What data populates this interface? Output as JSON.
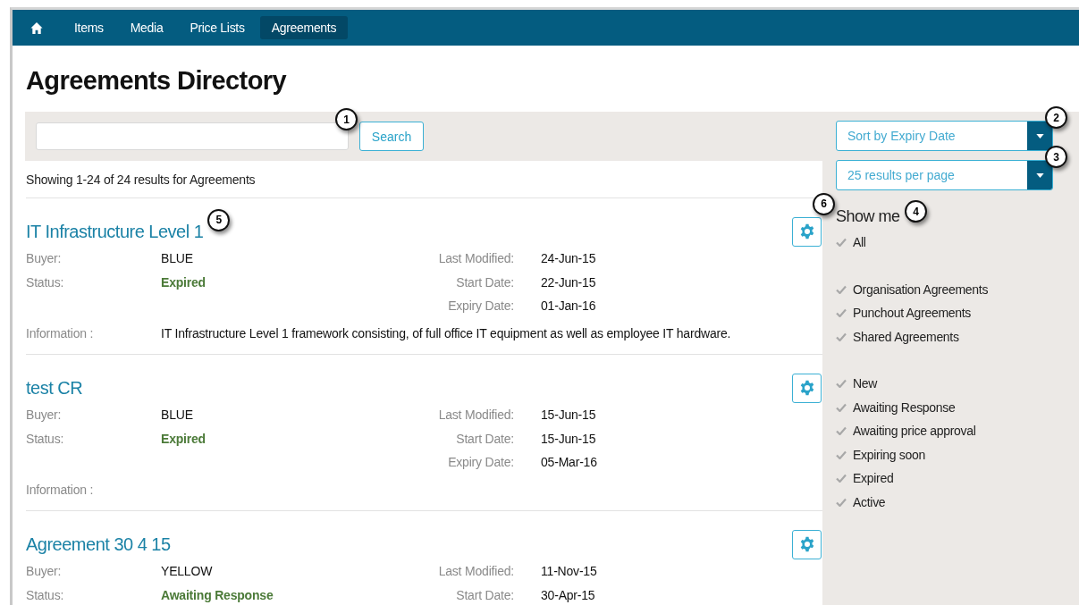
{
  "nav": {
    "items": [
      {
        "label": "Items",
        "selected": false
      },
      {
        "label": "Media",
        "selected": false
      },
      {
        "label": "Price Lists",
        "selected": false
      },
      {
        "label": "Agreements",
        "selected": true
      }
    ]
  },
  "page_title": "Agreements Directory",
  "search": {
    "button": "Search",
    "callout": "1"
  },
  "results_summary": "Showing 1-24 of 24 results for Agreements",
  "sort": {
    "value": "Sort by Expiry Date",
    "callout": "2"
  },
  "per_page": {
    "value": "25 results per page",
    "callout": "3"
  },
  "filters": {
    "title": "Show me",
    "callout": "4",
    "groups": [
      [
        "All"
      ],
      [
        "Organisation Agreements",
        "Punchout Agreements",
        "Shared Agreements"
      ],
      [
        "New",
        "Awaiting Response",
        "Awaiting price approval",
        "Expiring soon",
        "Expired",
        "Active"
      ]
    ]
  },
  "agreements": [
    {
      "title": "IT Infrastructure Level 1",
      "callout": "5",
      "settings_callout": "6",
      "left": [
        {
          "label": "Buyer:",
          "value": "BLUE",
          "kind": "plain"
        },
        {
          "label": "Status:",
          "value": "Expired",
          "kind": "status"
        }
      ],
      "right": [
        {
          "label": "Last Modified:",
          "value": "24-Jun-15"
        },
        {
          "label": "Start Date:",
          "value": "22-Jun-15"
        },
        {
          "label": "Expiry Date:",
          "value": "01-Jan-16"
        }
      ],
      "information": {
        "label": "Information :",
        "value": "IT Infrastructure Level 1 framework consisting, of full office IT equipment as well as employee IT hardware."
      }
    },
    {
      "title": "test CR",
      "left": [
        {
          "label": "Buyer:",
          "value": "BLUE",
          "kind": "plain"
        },
        {
          "label": "Status:",
          "value": "Expired",
          "kind": "status"
        }
      ],
      "right": [
        {
          "label": "Last Modified:",
          "value": "15-Jun-15"
        },
        {
          "label": "Start Date:",
          "value": "15-Jun-15"
        },
        {
          "label": "Expiry Date:",
          "value": "05-Mar-16"
        }
      ],
      "information": {
        "label": "Information :"
      }
    },
    {
      "title": "Agreement 30 4 15",
      "left": [
        {
          "label": "Buyer:",
          "value": "YELLOW",
          "kind": "plain"
        },
        {
          "label": "Status:",
          "value": "Awaiting Response",
          "kind": "status"
        }
      ],
      "right": [
        {
          "label": "Last Modified:",
          "value": "11-Nov-15"
        },
        {
          "label": "Start Date:",
          "value": "30-Apr-15"
        }
      ]
    }
  ]
}
